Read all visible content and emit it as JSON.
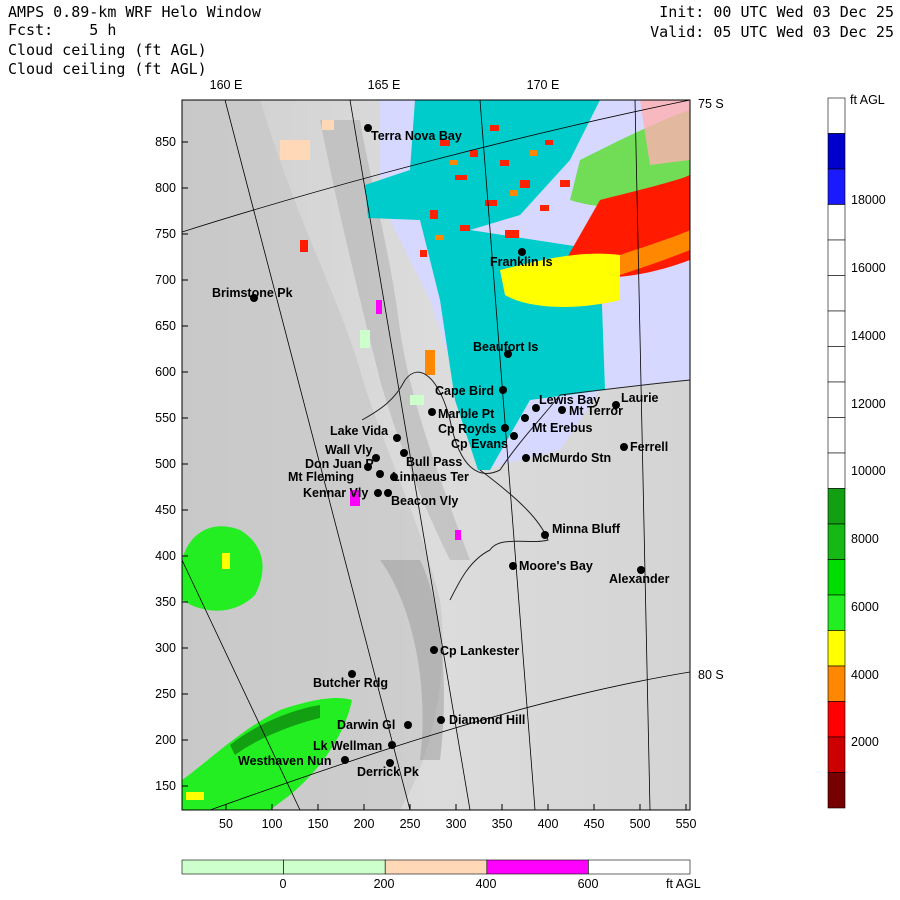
{
  "header": {
    "title_line1": "AMPS 0.89-km WRF Helo Window",
    "forecast": "Fcst:    5 h",
    "field1": "Cloud ceiling (ft AGL)",
    "field2": "Cloud ceiling (ft AGL)",
    "init": "Init: 00 UTC Wed 03 Dec 25",
    "valid": "Valid: 05 UTC Wed 03 Dec 25"
  },
  "axes": {
    "lon_labels": [
      "160 E",
      "165 E",
      "170 E"
    ],
    "lat_labels": [
      "75 S",
      "80 S"
    ],
    "y_ticks": [
      "850",
      "800",
      "750",
      "700",
      "650",
      "600",
      "550",
      "500",
      "450",
      "400",
      "350",
      "300",
      "250",
      "200",
      "150"
    ],
    "x_ticks": [
      "50",
      "100",
      "150",
      "200",
      "250",
      "300",
      "350",
      "400",
      "450",
      "500",
      "550"
    ]
  },
  "places": [
    {
      "name": "Terra Nova Bay"
    },
    {
      "name": "Brimstone Pk"
    },
    {
      "name": "Franklin Is"
    },
    {
      "name": "Beaufort Is"
    },
    {
      "name": "Cape Bird"
    },
    {
      "name": "Marble Pt"
    },
    {
      "name": "Lewis Bay"
    },
    {
      "name": "Mt Terror"
    },
    {
      "name": "Laurie"
    },
    {
      "name": "Cp Royds"
    },
    {
      "name": "Mt Erebus"
    },
    {
      "name": "Lake Vida"
    },
    {
      "name": "Cp Evans"
    },
    {
      "name": "Ferrell"
    },
    {
      "name": "Wall Vly"
    },
    {
      "name": "McMurdo Stn"
    },
    {
      "name": "Bull Pass"
    },
    {
      "name": "Don Juan P"
    },
    {
      "name": "Mt Fleming"
    },
    {
      "name": "Linnaeus Ter"
    },
    {
      "name": "Kennar Vly"
    },
    {
      "name": "Beacon Vly"
    },
    {
      "name": "Minna Bluff"
    },
    {
      "name": "Moore's Bay"
    },
    {
      "name": "Alexander"
    },
    {
      "name": "Cp Lankester"
    },
    {
      "name": "Butcher Rdg"
    },
    {
      "name": "Darwin Gl"
    },
    {
      "name": "Diamond Hill"
    },
    {
      "name": "Lk Wellman"
    },
    {
      "name": "Westhaven Nun"
    },
    {
      "name": "Derrick Pk"
    }
  ],
  "right_colorbar": {
    "unit": "ft AGL",
    "labels": [
      "18000",
      "16000",
      "14000",
      "12000",
      "10000",
      "8000",
      "6000",
      "4000",
      "2000"
    ],
    "colors": [
      "#ffffff",
      "#0000cc",
      "#1a1aff",
      "#ffffff",
      "#ffffff",
      "#ffffff",
      "#ffffff",
      "#ffffff",
      "#ffffff",
      "#ffffff",
      "#ffffff",
      "#12a012",
      "#16b816",
      "#00dd00",
      "#22ee22",
      "#ffff00",
      "#ff8800",
      "#ff0000",
      "#cc0000",
      "#770000"
    ]
  },
  "bottom_colorbar": {
    "unit": "ft AGL",
    "labels": [
      "0",
      "200",
      "400",
      "600"
    ],
    "colors": [
      "#ccffcc",
      "#ccffcc",
      "#ffd8b8",
      "#ff00ff",
      "#ffffff"
    ]
  },
  "colors": {
    "ocean_cloud": "#00cccc",
    "haze": "#d6d8ff",
    "land": "#d8d8d8"
  }
}
